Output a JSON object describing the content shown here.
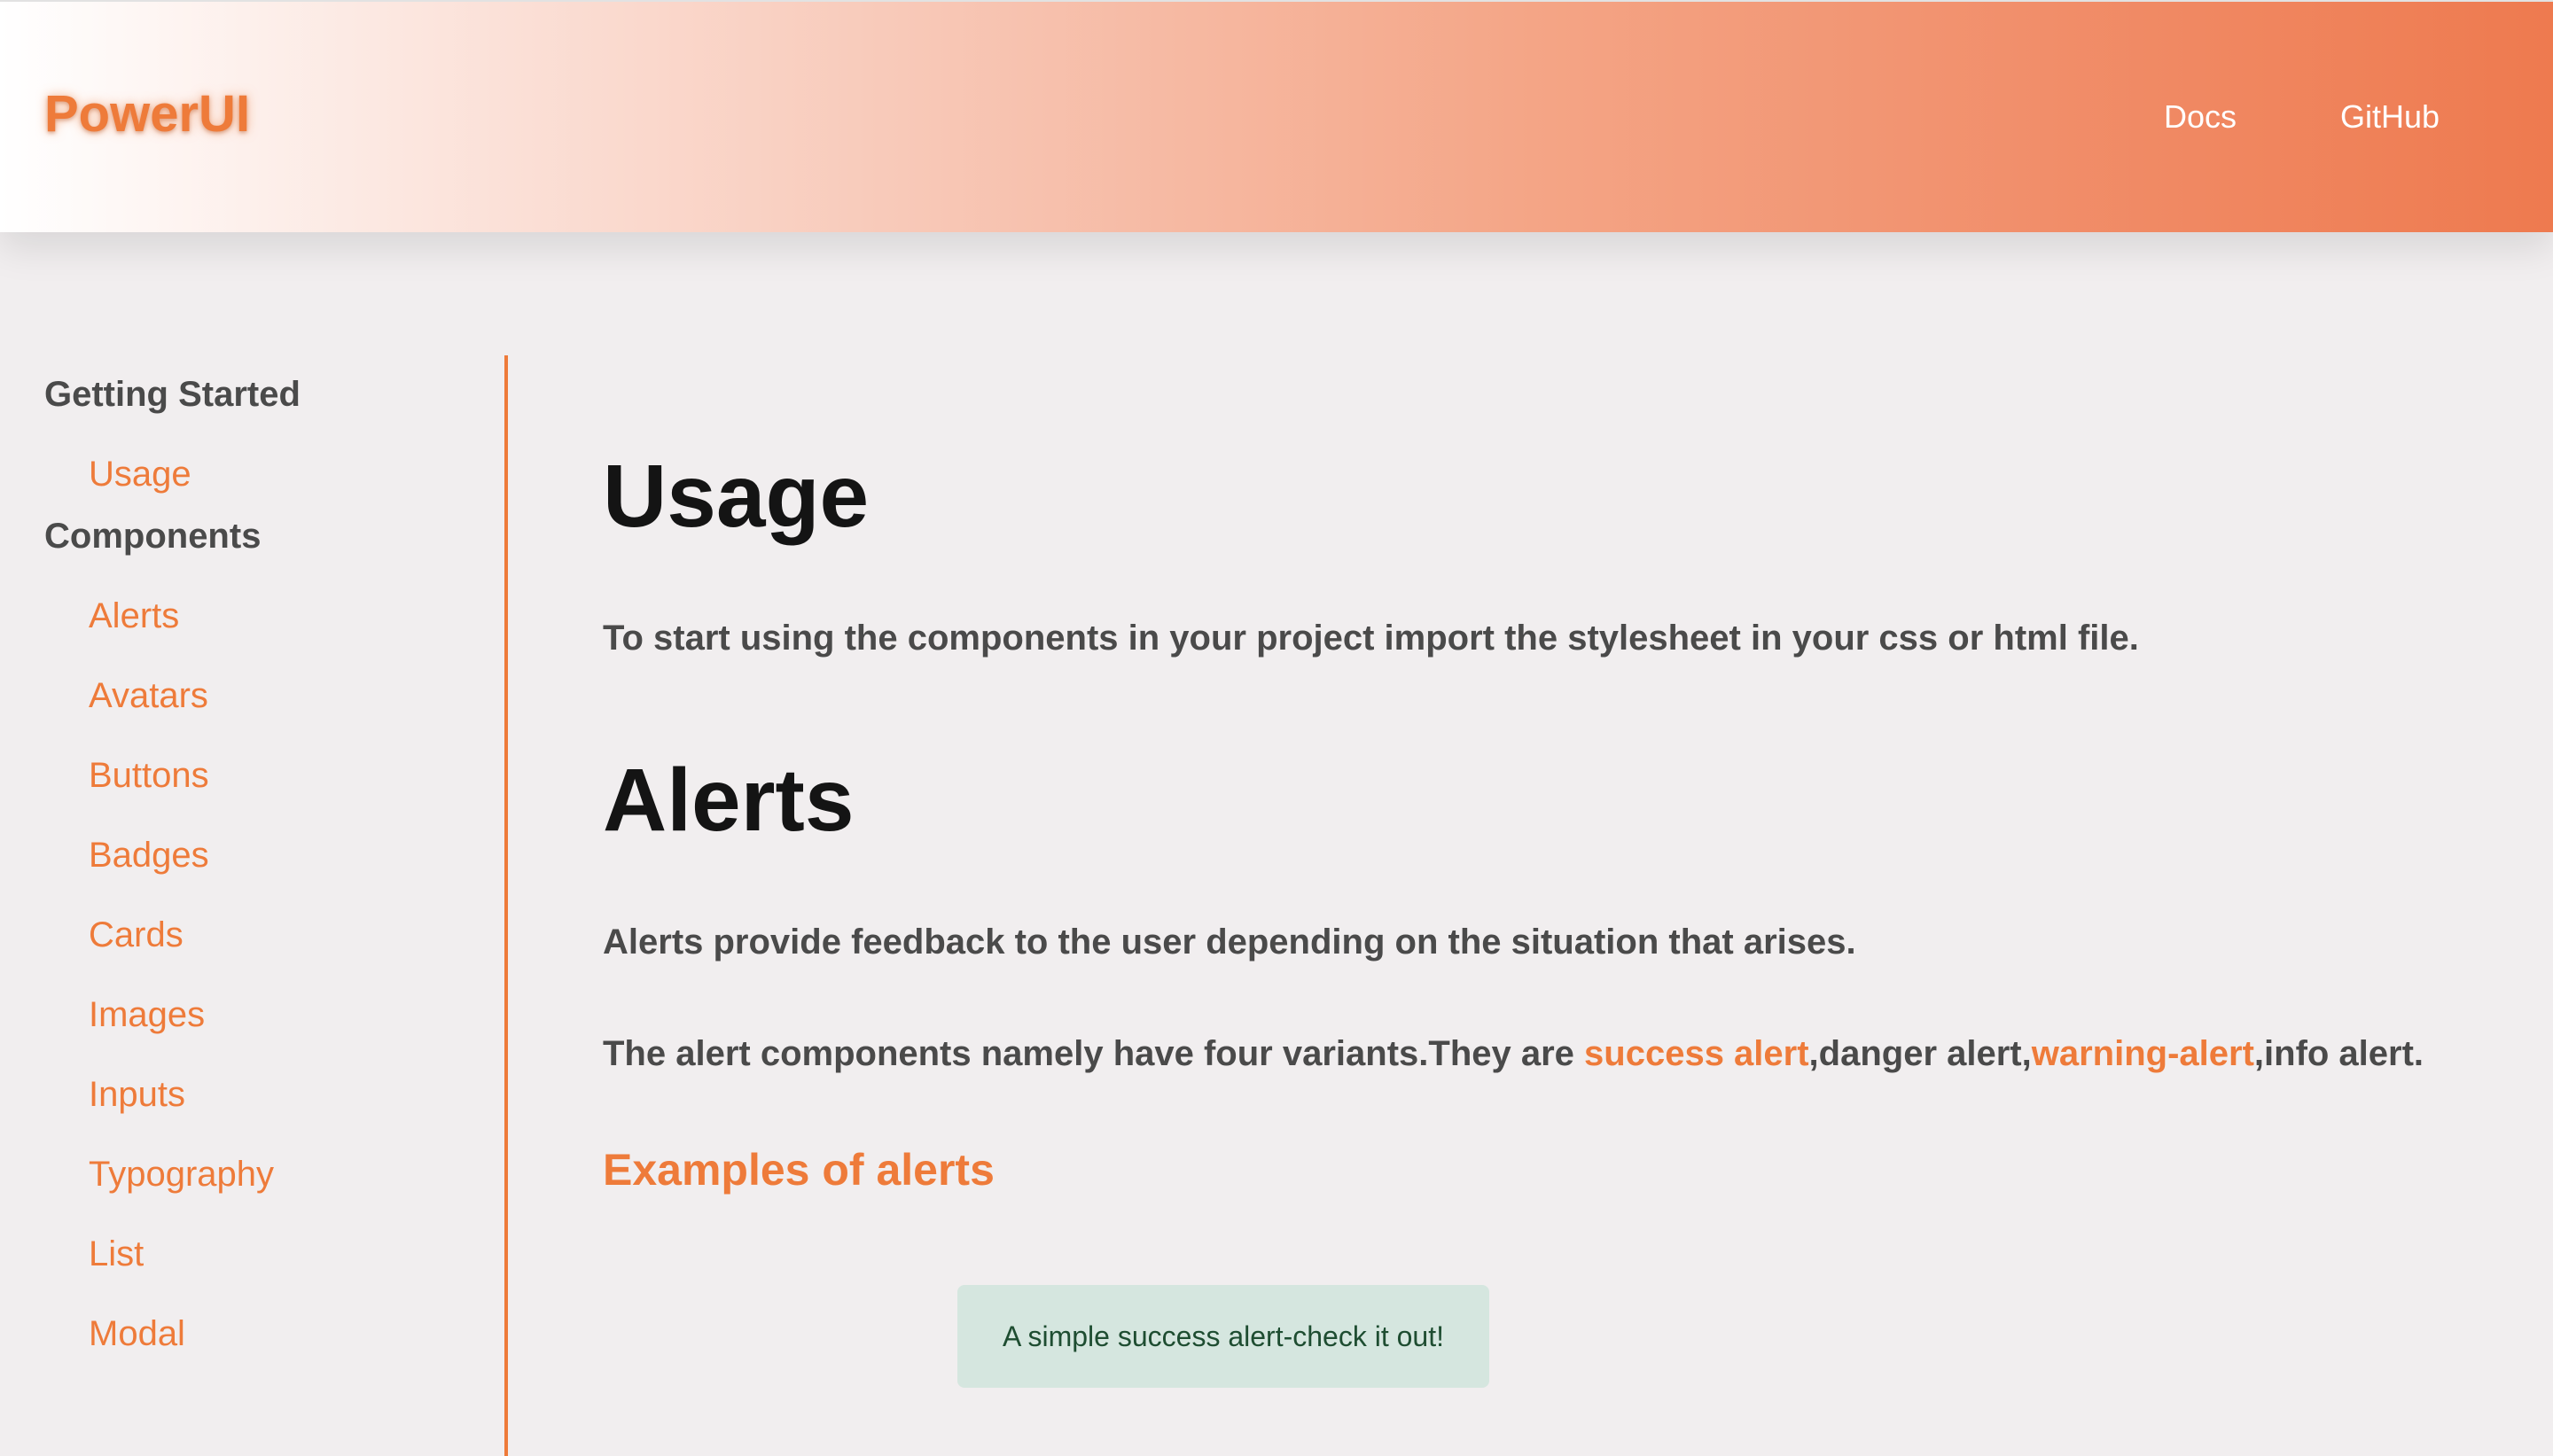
{
  "navbar": {
    "brand": "PowerUI",
    "links": [
      "Docs",
      "GitHub"
    ]
  },
  "sidebar": {
    "sections": [
      {
        "heading": "Getting Started",
        "items": [
          "Usage"
        ]
      },
      {
        "heading": "Components",
        "items": [
          "Alerts",
          "Avatars",
          "Buttons",
          "Badges",
          "Cards",
          "Images",
          "Inputs",
          "Typography",
          "List",
          "Modal"
        ]
      }
    ]
  },
  "main": {
    "usage": {
      "title": "Usage",
      "text": "To start using the components in your project import the stylesheet in your css or html file."
    },
    "alerts": {
      "title": "Alerts",
      "intro": "Alerts provide feedback to the user depending on the situation that arises.",
      "variants_prefix": "The alert components namely have four variants.They are ",
      "variant_success": "success alert",
      "variant_sep1": ",danger alert,",
      "variant_warning": "warning-alert",
      "variant_suffix": ",info alert.",
      "examples_heading": "Examples of alerts",
      "example_success": "A simple success alert-check it out!"
    }
  },
  "colors": {
    "accent": "#ee7b3a",
    "heading": "#141414",
    "text": "#4a4a4a",
    "background": "#f1eeef",
    "success_bg": "#d5e6df",
    "success_text": "#1e4d31"
  }
}
